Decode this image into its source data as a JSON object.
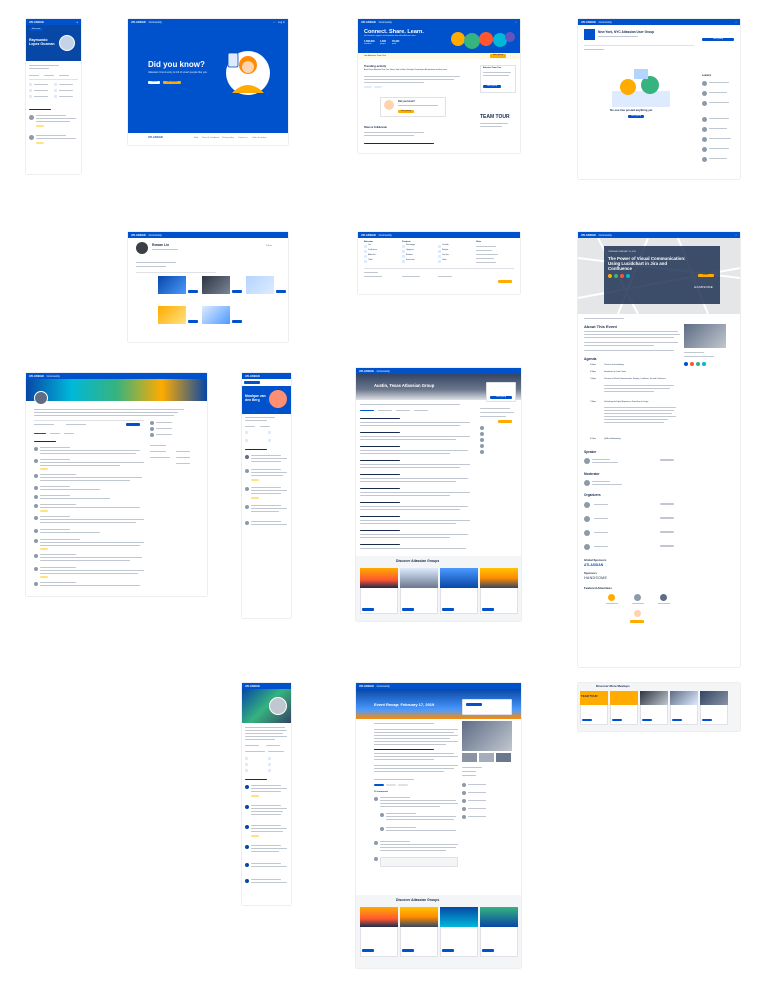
{
  "brand": {
    "logo": "ATLASSIAN",
    "community": "Community",
    "accent": "#0052cc",
    "highlight": "#ffab00"
  },
  "profile_mobile": {
    "name": "Raymundo Lopez Guzman",
    "join_label": "Join now"
  },
  "did_you_know": {
    "title": "Did you know?",
    "subtitle": "Atlassian Community is full of smart people like you",
    "cancel_label": "Cancel",
    "cta_label": "Get started",
    "footer_links": [
      "Help",
      "Terms & Conditions",
      "Privacy policy",
      "Contact us",
      "Code of conduct"
    ]
  },
  "groups_home": {
    "hero_title": "Connect. Share. Learn.",
    "hero_subtitle": "Find answers, support, and inspiration from other Atlassian users",
    "stats": [
      {
        "value": "1,560,840",
        "label": "members"
      },
      {
        "value": "1,600",
        "label": "groups"
      },
      {
        "value": "78,232",
        "label": "posts"
      }
    ],
    "banner": "Join Atlassian Team Tour",
    "banner_button": "Join group",
    "post_title": "Trending activity",
    "post_body": "Anna Karina: Atlassian Team Tour Shares Jobs to Help in Strategic Partnerships. Ask questions and learn more",
    "cta_title": "Did you know?",
    "cta_button": "Join group",
    "section_title": "Share & Collaborate",
    "side_title": "Atlassian Team Tour",
    "side_button": "Join group",
    "team_tour": "TEAM TOUR"
  },
  "nyc_group": {
    "title": "New York, NYC Atlassian User Group",
    "empty_title": "No one has posted anything yet",
    "empty_button": "Join group",
    "sidebar_title": "Leaders",
    "join_button": "Join group"
  },
  "rowan": {
    "name": "Rowan Lin",
    "button": "Follow"
  },
  "menu": {
    "cols": [
      "Atlassian",
      "Products",
      "Other"
    ],
    "items": [
      "Jira",
      "Confluence",
      "Bitbucket",
      "Trello",
      "Statuspage",
      "Opsgenie",
      "Bamboo",
      "Sourcetree",
      "Crucible",
      "Fisheye",
      "Jira Ops",
      "Other"
    ]
  },
  "meetup": {
    "event_date": "THURSDAY, FEBRUARY 14, 2019",
    "event_title": "The Power of Visual Communication: Using Lucidchart in Jira and Confluence",
    "rsvp": "RSVP",
    "sponsor": "HANDSOME",
    "about_title": "About This Event",
    "agenda_title": "Agenda",
    "agenda": [
      {
        "time": "6:00pm",
        "text": "Check-in and networking"
      },
      {
        "time": "6:30pm",
        "text": "Introduction to Lucid Charts"
      },
      {
        "time": "7:00pm",
        "text": "Overview of Visual Communication: Designs, Lucidchart, Jira and Confluence"
      },
      {
        "time": "7:30pm",
        "text": "Unleashing the Digital Experience: From Idea to Design"
      },
      {
        "time": "8:15pm",
        "text": "Q&A and Networking"
      }
    ],
    "speaker_title": "Speaker",
    "moderator_title": "Moderator",
    "organizers_title": "Organizers",
    "global_sponsors": "Global Sponsors",
    "atlassian": "ATLASSIAN",
    "sponsors": "Sponsors",
    "handsome": "HANDSOME",
    "featured": "Featured Attendees",
    "more_title": "Discover More Meetups",
    "team_tour": "TEAM TOUR"
  },
  "austin": {
    "title": "Austin, Texas Atlassian Group",
    "join": "Join group",
    "discover": "Discover Atlassian Groups"
  },
  "event_recap": {
    "title": "Event Recap: February 17, 2019",
    "discover": "Discover Atlassian Groups",
    "comments": "12 comments"
  },
  "profile2": {
    "name": "Monique van den Berg",
    "button": "Follow"
  }
}
